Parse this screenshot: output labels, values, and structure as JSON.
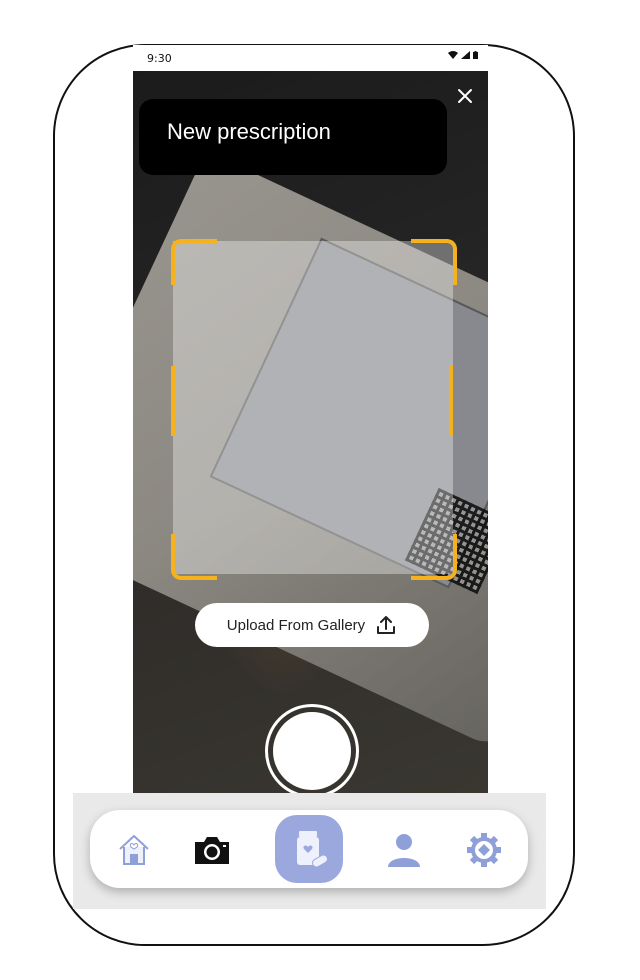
{
  "status_bar": {
    "time": "9:30"
  },
  "header": {
    "title": "New prescription",
    "close_icon": "close-icon"
  },
  "scanner": {
    "upload_label": "Upload From Gallery",
    "upload_icon": "upload-icon"
  },
  "bottom_nav": {
    "items": [
      {
        "id": "home",
        "icon": "home-icon"
      },
      {
        "id": "camera",
        "icon": "camera-icon"
      },
      {
        "id": "prescription",
        "icon": "medicine-bottle-icon",
        "active": true
      },
      {
        "id": "profile",
        "icon": "user-icon"
      },
      {
        "id": "settings",
        "icon": "gear-icon"
      }
    ]
  },
  "colors": {
    "accent": "#f5b21e",
    "nav_active": "#9aa8dd",
    "icon_blue": "#8ea0d7"
  }
}
